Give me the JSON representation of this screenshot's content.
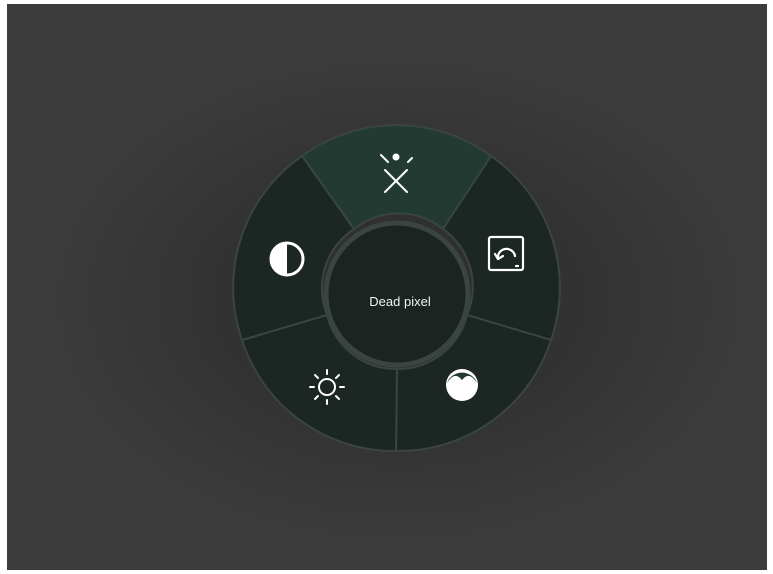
{
  "radial_menu": {
    "center": {
      "label": "Dead pixel"
    },
    "items": [
      {
        "icon": "dead-pixel-icon",
        "selected": true
      },
      {
        "icon": "screen-refresh-icon",
        "selected": false
      },
      {
        "icon": "color-range-icon",
        "selected": false
      },
      {
        "icon": "brightness-icon",
        "selected": false
      },
      {
        "icon": "contrast-icon",
        "selected": false
      }
    ]
  },
  "colors": {
    "segment": "#1c2622",
    "segment_selected": "#223a32",
    "center": "#1b2420",
    "divider": "#3a4540",
    "icon": "#ffffff"
  }
}
